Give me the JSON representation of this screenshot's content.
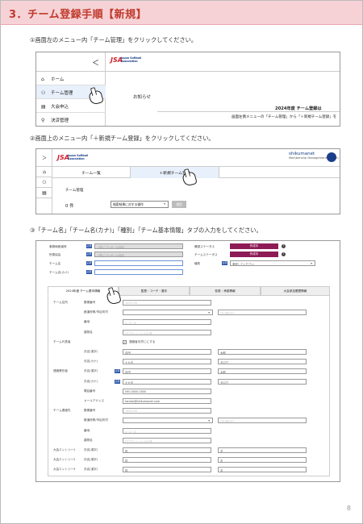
{
  "header": {
    "title": "3．チーム登録手順【新規】"
  },
  "steps": [
    "①画面左のメニュー内「チーム管理」をクリックしてください。",
    "②画面上のメニュー内「＋新規チーム登録」をクリックしてください。",
    "③「チーム名」「チーム名(カナ)」「種別」「チーム基本情報」タブの入力をしてください。"
  ],
  "screen1": {
    "chevron": "＜",
    "logo_text": "JSA",
    "logo_sub": "Japan Softball Association",
    "sidebar": [
      {
        "icon": "⌂",
        "label": "ホーム"
      },
      {
        "icon": "⚇",
        "label": "チーム管理"
      },
      {
        "icon": "▤",
        "label": "大会申込"
      },
      {
        "icon": "⚲",
        "label": "決済管理"
      }
    ],
    "notice_label": "お知らせ",
    "notice_title": "2024年度 チーム登録は",
    "notice_body": "画面左側メニューの「チーム管理」から「＋新規チーム登録」を"
  },
  "screen2": {
    "chevron": "＞",
    "side_icons": [
      "⌂",
      "⚇",
      "▤"
    ],
    "brand": "shikumanet",
    "brand_sub": "Membership Management System",
    "tabs": [
      "チーム一覧",
      "＋新規チーム登録"
    ],
    "page_title": "チーム管理",
    "count": "0 件",
    "filter_value": "検索結果に対する操作",
    "apply_button": "適用"
  },
  "screen3": {
    "left_fields": [
      {
        "label": "事務局都道府",
        "req": "必須",
        "value": "一般ソフトボール協会",
        "style": "gray"
      },
      {
        "label": "所属協会",
        "req": "必須",
        "value": "一般ソフトボール協会",
        "style": "gray"
      },
      {
        "label": "チーム名",
        "req": "必須",
        "value": "",
        "style": "blue"
      },
      {
        "label": "チーム名(カナ)",
        "req": "必須",
        "value": "",
        "style": "blue"
      }
    ],
    "right_fields": [
      {
        "label": "確認ステータス",
        "pill": "作成中"
      },
      {
        "label": "チームステータス",
        "pill": "作成中"
      },
      {
        "label": "種別",
        "req": "必須",
        "value": "選択してください"
      }
    ],
    "tabs": [
      "2024年度 チーム基本情報",
      "監督・コーチ・選手",
      "役員・承認情報",
      "大会参加履歴情報"
    ],
    "rows": [
      {
        "label": "チーム住所",
        "sub": "郵便番号",
        "v1": "1001230",
        "v2": ""
      },
      {
        "label": "",
        "sub": "都道府県/市区町村",
        "v1": "",
        "v2": "〇〇市〇〇"
      },
      {
        "label": "",
        "sub": "番地",
        "v1": "1－2－3",
        "v2": ""
      },
      {
        "label": "",
        "sub": "建物名",
        "v1": "〇〇マンション101号",
        "v2": ""
      },
      {
        "label": "チーム代表者",
        "sub": "",
        "v1": "連絡者を同じにする",
        "v2": ""
      },
      {
        "label": "",
        "sub": "氏名(漢字)",
        "v1": "中田",
        "v2": "太郎"
      },
      {
        "label": "",
        "sub": "氏名(カナ)",
        "v1": "ナカタ",
        "v2": "タロウ"
      },
      {
        "label": "連絡責任者",
        "sub": "氏名(漢字)",
        "v1": "中田",
        "v2": "太郎"
      },
      {
        "label": "",
        "sub": "氏名(カナ)",
        "v1": "ナカタ",
        "v2": "タロウ"
      },
      {
        "label": "",
        "sub": "電話番号",
        "v1": "090-0000-0000",
        "v2": ""
      },
      {
        "label": "",
        "sub": "メールアドレス",
        "v1": "tanaka@shikumanet.com",
        "v2": ""
      },
      {
        "label": "チーム連絡先",
        "sub": "郵便番号",
        "v1": "1001230",
        "v2": ""
      },
      {
        "label": "",
        "sub": "都道府県/市区町村",
        "v1": "",
        "v2": "〇〇市〇〇"
      },
      {
        "label": "",
        "sub": "番地",
        "v1": "1－2－3",
        "v2": ""
      },
      {
        "label": "",
        "sub": "建物名",
        "v1": "〇〇マンション101号",
        "v2": ""
      },
      {
        "label": "大会エントリー1",
        "sub": "氏名(漢字)",
        "v1": "姓",
        "v2": "名"
      },
      {
        "label": "大会エントリー2",
        "sub": "氏名(漢字)",
        "v1": "姓",
        "v2": "名"
      },
      {
        "label": "大会エントリー3",
        "sub": "氏名(漢字)",
        "v1": "姓",
        "v2": "名"
      }
    ]
  },
  "page_number": "8"
}
